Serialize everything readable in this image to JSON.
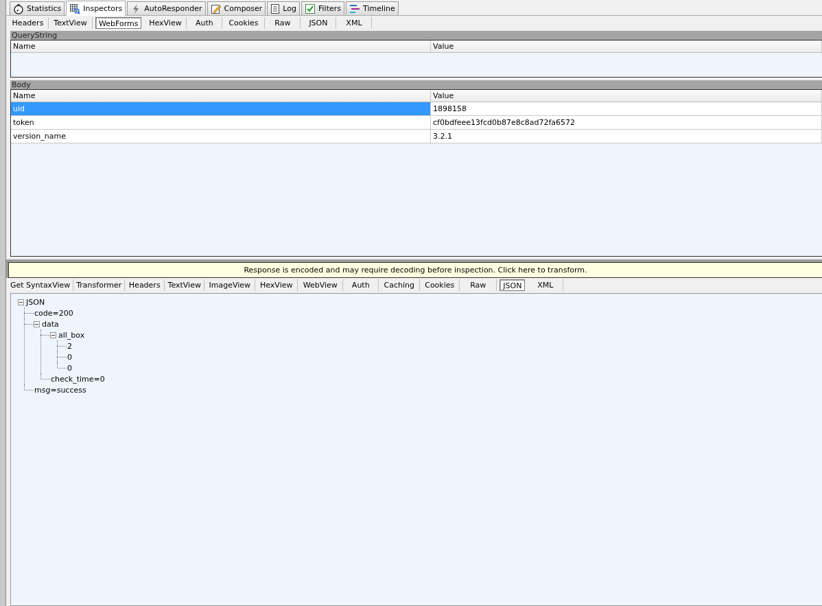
{
  "main_tabs": [
    {
      "label": "Statistics",
      "selected": false
    },
    {
      "label": "Inspectors",
      "selected": true
    },
    {
      "label": "AutoResponder",
      "selected": false
    },
    {
      "label": "Composer",
      "selected": false
    },
    {
      "label": "Log",
      "selected": false
    },
    {
      "label": "Filters",
      "selected": false
    },
    {
      "label": "Timeline",
      "selected": false
    }
  ],
  "request_tabs": [
    {
      "label": "Headers",
      "selected": false
    },
    {
      "label": "TextView",
      "selected": false
    },
    {
      "label": "WebForms",
      "selected": true
    },
    {
      "label": "HexView",
      "selected": false
    },
    {
      "label": "Auth",
      "selected": false
    },
    {
      "label": "Cookies",
      "selected": false
    },
    {
      "label": "Raw",
      "selected": false
    },
    {
      "label": "JSON",
      "selected": false
    },
    {
      "label": "XML",
      "selected": false
    }
  ],
  "query_string": {
    "title": "QueryString",
    "columns": [
      "Name",
      "Value"
    ]
  },
  "body": {
    "title": "Body",
    "columns": [
      "Name",
      "Value"
    ],
    "rows": [
      {
        "name": "uid",
        "value": "1898158",
        "selected": true
      },
      {
        "name": "token",
        "value": "cf0bdfeee13fcd0b87e8c8ad72fa6572",
        "selected": false
      },
      {
        "name": "version_name",
        "value": "3.2.1",
        "selected": false
      }
    ]
  },
  "response_banner": "Response is encoded and may require decoding before inspection. Click here to transform.",
  "response_tabs": [
    {
      "label": "Get SyntaxView",
      "selected": false
    },
    {
      "label": "Transformer",
      "selected": false
    },
    {
      "label": "Headers",
      "selected": false
    },
    {
      "label": "TextView",
      "selected": false
    },
    {
      "label": "ImageView",
      "selected": false
    },
    {
      "label": "HexView",
      "selected": false
    },
    {
      "label": "WebView",
      "selected": false
    },
    {
      "label": "Auth",
      "selected": false
    },
    {
      "label": "Caching",
      "selected": false
    },
    {
      "label": "Cookies",
      "selected": false
    },
    {
      "label": "Raw",
      "selected": false
    },
    {
      "label": "JSON",
      "selected": true
    },
    {
      "label": "XML",
      "selected": false
    }
  ],
  "json_tree": [
    {
      "label": "JSON",
      "expanded": true,
      "children": [
        {
          "label": "code=200"
        },
        {
          "label": "data",
          "expanded": true,
          "children": [
            {
              "label": "all_box",
              "expanded": true,
              "children": [
                {
                  "label": "2"
                },
                {
                  "label": "0"
                },
                {
                  "label": "0"
                }
              ]
            },
            {
              "label": "check_time=0"
            }
          ]
        },
        {
          "label": "msg=success"
        }
      ]
    }
  ]
}
